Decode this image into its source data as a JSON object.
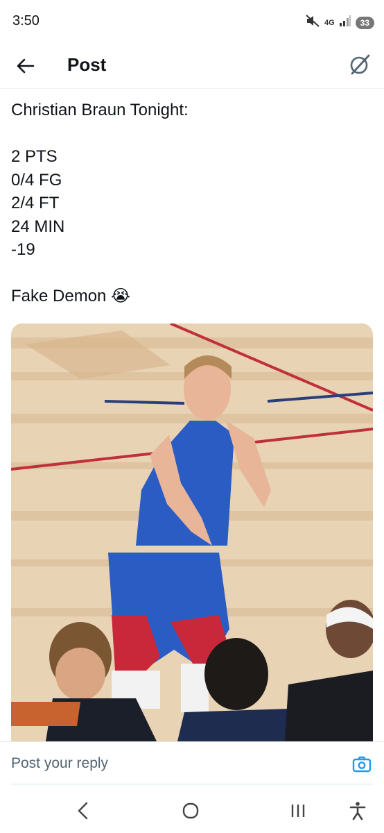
{
  "status_bar": {
    "time": "3:50",
    "network": "4G",
    "battery": "33"
  },
  "header": {
    "title": "Post"
  },
  "post": {
    "lines": [
      "Christian Braun Tonight:",
      "",
      "2 PTS",
      "0/4 FG",
      "2/4 FT",
      "24 MIN",
      "-19",
      "",
      "Fake Demon 😭"
    ]
  },
  "reply": {
    "placeholder": "Post your reply"
  },
  "icons": {
    "back": "arrow-left-icon",
    "grok": "grok-icon",
    "camera": "camera-icon",
    "nav_back": "chevron-left-icon",
    "nav_home": "home-circle-icon",
    "nav_recents": "recents-icon",
    "accessibility": "accessibility-icon"
  },
  "colors": {
    "accent": "#1d9bf0",
    "text": "#0f1419",
    "muted": "#536471"
  }
}
